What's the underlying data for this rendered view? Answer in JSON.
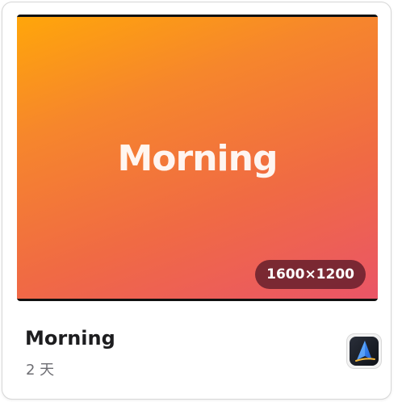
{
  "card": {
    "thumbnail": {
      "title": "Morning",
      "resolution": "1600×1200"
    },
    "title": "Morning",
    "subtitle": "2 天",
    "app_icon": "spark-arrow-app-icon"
  },
  "colors": {
    "gradient_start": "#ffa60a",
    "gradient_end": "#ea5567",
    "badge_bg": "#5a1928"
  }
}
